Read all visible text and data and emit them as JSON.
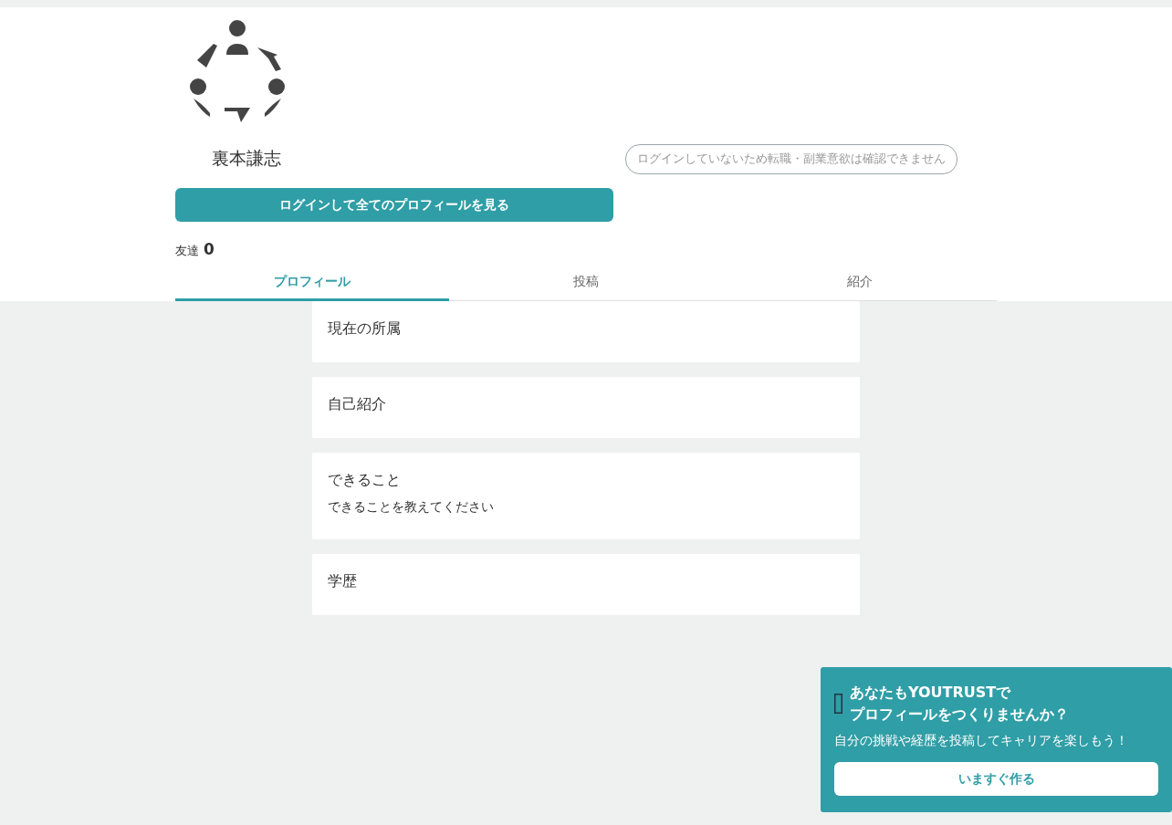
{
  "profile": {
    "name": "裏本謙志",
    "status_note": "ログインしていないため転職・副業意欲は確認できません",
    "login_button": "ログインして全てのプロフィールを見る",
    "friends": {
      "label": "友達",
      "count": "0"
    }
  },
  "tabs": [
    {
      "label": "プロフィール",
      "selected": true
    },
    {
      "label": "投稿",
      "selected": false
    },
    {
      "label": "紹介",
      "selected": false
    }
  ],
  "sections": [
    {
      "title": "現在の所属"
    },
    {
      "title": "自己紹介"
    },
    {
      "title": "できること",
      "body": "できることを教えてください"
    },
    {
      "title": "学歴"
    }
  ],
  "promo": {
    "title_lines": [
      "あなたもYOUTRUSTで",
      "プロフィールをつくりませんか？"
    ],
    "text": "自分の挑戦や経歴を投稿してキャリアを楽しもう！",
    "button": "いますぐ作る"
  }
}
